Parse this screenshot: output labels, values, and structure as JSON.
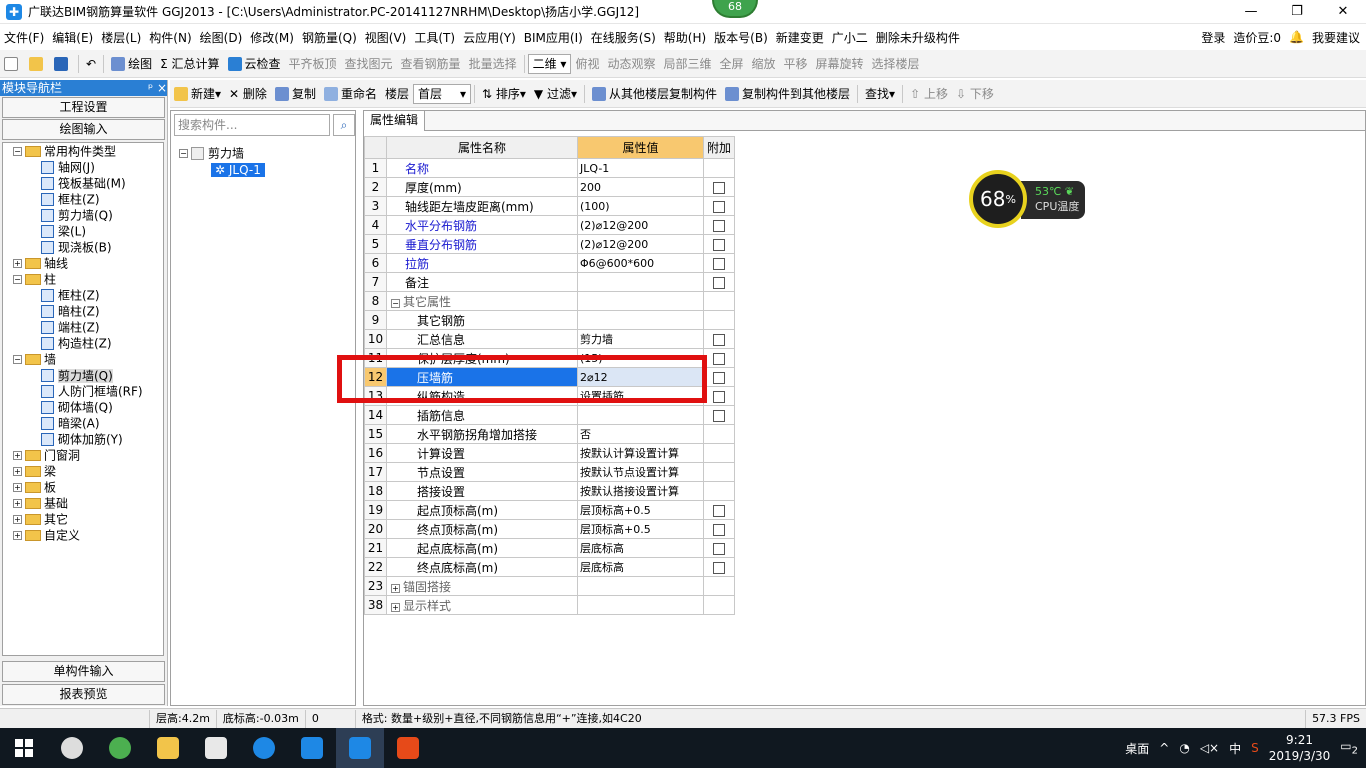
{
  "title_bar": {
    "app_title": "广联达BIM钢筋算量软件 GGJ2013 - [C:\\Users\\Administrator.PC-20141127NRHM\\Desktop\\扬店小学.GGJ12]",
    "minimize": "—",
    "restore": "❐",
    "close": "✕"
  },
  "top_badge": "68",
  "menu": {
    "items": [
      "文件(F)",
      "编辑(E)",
      "楼层(L)",
      "构件(N)",
      "绘图(D)",
      "修改(M)",
      "钢筋量(Q)",
      "视图(V)",
      "工具(T)",
      "云应用(Y)",
      "BIM应用(I)",
      "在线服务(S)",
      "帮助(H)",
      "版本号(B)",
      "新建变更",
      "广小二",
      "删除未升级构件"
    ],
    "login": "登录",
    "price_beans": "造价豆:0",
    "suggest": "我要建议"
  },
  "toolbar1": {
    "draw": "绘图",
    "sum": "汇总计算",
    "cloud_check": "云检查",
    "flat_slab": "平齐板顶",
    "find_elem": "查找图元",
    "view_rebar": "查看钢筋量",
    "batch_select": "批量选择",
    "view_mode": "二维",
    "top_view": "俯视",
    "dynamic_obs": "动态观察",
    "local_3d": "局部三维",
    "fullscreen": "全屏",
    "zoom": "缩放",
    "pan": "平移",
    "screen_rotate": "屏幕旋转",
    "select_floor": "选择楼层"
  },
  "nav": {
    "title": "模块导航栏",
    "pin": "ᵖ ×",
    "project_settings": "工程设置",
    "drawing_input": "绘图输入",
    "single_input": "单构件输入",
    "report_preview": "报表预览",
    "tree": [
      {
        "label": "常用构件类型",
        "lvl": 0,
        "type": "folder",
        "exp": "−"
      },
      {
        "label": "轴网(J)",
        "lvl": 1,
        "type": "item"
      },
      {
        "label": "筏板基础(M)",
        "lvl": 1,
        "type": "item"
      },
      {
        "label": "框柱(Z)",
        "lvl": 1,
        "type": "item"
      },
      {
        "label": "剪力墙(Q)",
        "lvl": 1,
        "type": "item"
      },
      {
        "label": "梁(L)",
        "lvl": 1,
        "type": "item"
      },
      {
        "label": "现浇板(B)",
        "lvl": 1,
        "type": "item"
      },
      {
        "label": "轴线",
        "lvl": 0,
        "type": "folder",
        "exp": "+"
      },
      {
        "label": "柱",
        "lvl": 0,
        "type": "folder",
        "exp": "−"
      },
      {
        "label": "框柱(Z)",
        "lvl": 1,
        "type": "item"
      },
      {
        "label": "暗柱(Z)",
        "lvl": 1,
        "type": "item"
      },
      {
        "label": "端柱(Z)",
        "lvl": 1,
        "type": "item"
      },
      {
        "label": "构造柱(Z)",
        "lvl": 1,
        "type": "item"
      },
      {
        "label": "墙",
        "lvl": 0,
        "type": "folder",
        "exp": "−"
      },
      {
        "label": "剪力墙(Q)",
        "lvl": 1,
        "type": "item",
        "sel": true
      },
      {
        "label": "人防门框墙(RF)",
        "lvl": 1,
        "type": "item"
      },
      {
        "label": "砌体墙(Q)",
        "lvl": 1,
        "type": "item"
      },
      {
        "label": "暗梁(A)",
        "lvl": 1,
        "type": "item"
      },
      {
        "label": "砌体加筋(Y)",
        "lvl": 1,
        "type": "item"
      },
      {
        "label": "门窗洞",
        "lvl": 0,
        "type": "folder",
        "exp": "+"
      },
      {
        "label": "梁",
        "lvl": 0,
        "type": "folder",
        "exp": "+"
      },
      {
        "label": "板",
        "lvl": 0,
        "type": "folder",
        "exp": "+"
      },
      {
        "label": "基础",
        "lvl": 0,
        "type": "folder",
        "exp": "+"
      },
      {
        "label": "其它",
        "lvl": 0,
        "type": "folder",
        "exp": "+"
      },
      {
        "label": "自定义",
        "lvl": 0,
        "type": "folder",
        "exp": "+"
      }
    ]
  },
  "comp_toolbar": {
    "new": "新建",
    "delete": "删除",
    "copy": "复制",
    "rename": "重命名",
    "floor_label": "楼层",
    "floor_value": "首层",
    "sort": "排序",
    "filter": "过滤",
    "copy_from_other": "从其他楼层复制构件",
    "copy_to_other": "复制构件到其他楼层",
    "find": "查找",
    "up": "上移",
    "down": "下移"
  },
  "comp_list": {
    "search_placeholder": "搜索构件...",
    "root": "剪力墙",
    "child": "JLQ-1"
  },
  "prop_editor": {
    "tab": "属性编辑",
    "col_name": "属性名称",
    "col_value": "属性值",
    "col_add": "附加",
    "rows": [
      {
        "n": "1",
        "name": "名称",
        "value": "JLQ-1",
        "style": "blue",
        "cb": false
      },
      {
        "n": "2",
        "name": "厚度(mm)",
        "value": "200",
        "style": "",
        "cb": true
      },
      {
        "n": "3",
        "name": "轴线距左墙皮距离(mm)",
        "value": "(100)",
        "style": "",
        "cb": true
      },
      {
        "n": "4",
        "name": "水平分布钢筋",
        "value": "(2)⌀12@200",
        "style": "blue",
        "cb": true
      },
      {
        "n": "5",
        "name": "垂直分布钢筋",
        "value": "(2)⌀12@200",
        "style": "blue",
        "cb": true
      },
      {
        "n": "6",
        "name": "拉筋",
        "value": "Φ6@600*600",
        "style": "blue",
        "cb": true
      },
      {
        "n": "7",
        "name": "备注",
        "value": "",
        "style": "",
        "cb": true
      },
      {
        "n": "8",
        "name": "其它属性",
        "value": "",
        "style": "grp",
        "cb": false,
        "exp": "−"
      },
      {
        "n": "9",
        "name": "其它钢筋",
        "value": "",
        "style": "sub",
        "cb": false
      },
      {
        "n": "10",
        "name": "汇总信息",
        "value": "剪力墙",
        "style": "sub",
        "cb": true
      },
      {
        "n": "11",
        "name": "保护层厚度(mm)",
        "value": "(15)",
        "style": "sub",
        "cb": true
      },
      {
        "n": "12",
        "name": "压墙筋",
        "value": "2⌀12",
        "style": "sub",
        "cb": true,
        "sel": true
      },
      {
        "n": "13",
        "name": "纵筋构造",
        "value": "设置插筋",
        "style": "sub",
        "cb": true
      },
      {
        "n": "14",
        "name": "插筋信息",
        "value": "",
        "style": "sub",
        "cb": true
      },
      {
        "n": "15",
        "name": "水平钢筋拐角增加搭接",
        "value": "否",
        "style": "sub",
        "cb": false
      },
      {
        "n": "16",
        "name": "计算设置",
        "value": "按默认计算设置计算",
        "style": "sub",
        "cb": false
      },
      {
        "n": "17",
        "name": "节点设置",
        "value": "按默认节点设置计算",
        "style": "sub",
        "cb": false
      },
      {
        "n": "18",
        "name": "搭接设置",
        "value": "按默认搭接设置计算",
        "style": "sub",
        "cb": false
      },
      {
        "n": "19",
        "name": "起点顶标高(m)",
        "value": "层顶标高+0.5",
        "style": "sub",
        "cb": true
      },
      {
        "n": "20",
        "name": "终点顶标高(m)",
        "value": "层顶标高+0.5",
        "style": "sub",
        "cb": true
      },
      {
        "n": "21",
        "name": "起点底标高(m)",
        "value": "层底标高",
        "style": "sub",
        "cb": true
      },
      {
        "n": "22",
        "name": "终点底标高(m)",
        "value": "层底标高",
        "style": "sub",
        "cb": true
      },
      {
        "n": "23",
        "name": "锚固搭接",
        "value": "",
        "style": "grp",
        "cb": false,
        "exp": "+"
      },
      {
        "n": "38",
        "name": "显示样式",
        "value": "",
        "style": "grp",
        "cb": false,
        "exp": "+"
      }
    ]
  },
  "cpu_widget": {
    "percent": "68",
    "unit": "%",
    "temp": "53℃",
    "label": "CPU温度"
  },
  "status_bar": {
    "floor_height": "层高:4.2m",
    "bottom_elev": "底标高:-0.03m",
    "zero": "0",
    "hint": "格式: 数量+级别+直径,不同钢筋信息用“+”连接,如4C20",
    "fps": "57.3 FPS"
  },
  "taskbar": {
    "desktop": "桌面",
    "ime": "中",
    "time": "9:21",
    "date": "2019/3/30",
    "notif": "2"
  },
  "colors": {
    "accent": "#2a7fd4",
    "highlight_red": "#e01010",
    "header_orange": "#f8c86f"
  }
}
